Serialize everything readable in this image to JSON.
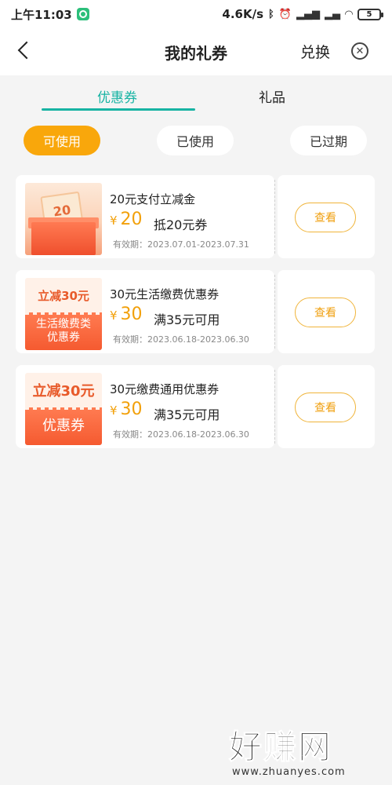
{
  "status_bar": {
    "time": "上午11:03",
    "net_speed": "4.6K/s",
    "battery": "5"
  },
  "nav": {
    "title": "我的礼券",
    "exchange_label": "兑换",
    "close_symbol": "✕"
  },
  "tabs": [
    {
      "label": "优惠券",
      "active": true
    },
    {
      "label": "礼品",
      "active": false
    }
  ],
  "filters": [
    {
      "label": "可使用",
      "active": true
    },
    {
      "label": "已使用",
      "active": false
    },
    {
      "label": "已过期",
      "active": false
    }
  ],
  "coupons": [
    {
      "title": "20元支付立减金",
      "currency": "¥",
      "amount": "20",
      "condition": "抵20元券",
      "validity": "有效期：2023.07.01-2023.07.31",
      "thumb_text": "20",
      "button": "查看"
    },
    {
      "title": "30元生活缴费优惠券",
      "currency": "¥",
      "amount": "30",
      "condition": "满35元可用",
      "validity": "有效期：2023.06.18-2023.06.30",
      "thumb_top": "立减30元",
      "thumb_bottom_1": "生活缴费类",
      "thumb_bottom_2": "优惠券",
      "button": "查看"
    },
    {
      "title": "30元缴费通用优惠券",
      "currency": "¥",
      "amount": "30",
      "condition": "满35元可用",
      "validity": "有效期：2023.06.18-2023.06.30",
      "thumb_top": "立减30元",
      "thumb_bottom_1": "优惠券",
      "button": "查看"
    }
  ],
  "watermark": {
    "brand": "好赚网",
    "url": "www.zhuanyes.com"
  },
  "colors": {
    "accent_teal": "#17b3a3",
    "accent_orange": "#f9a70b",
    "price_orange": "#f2a00a"
  }
}
